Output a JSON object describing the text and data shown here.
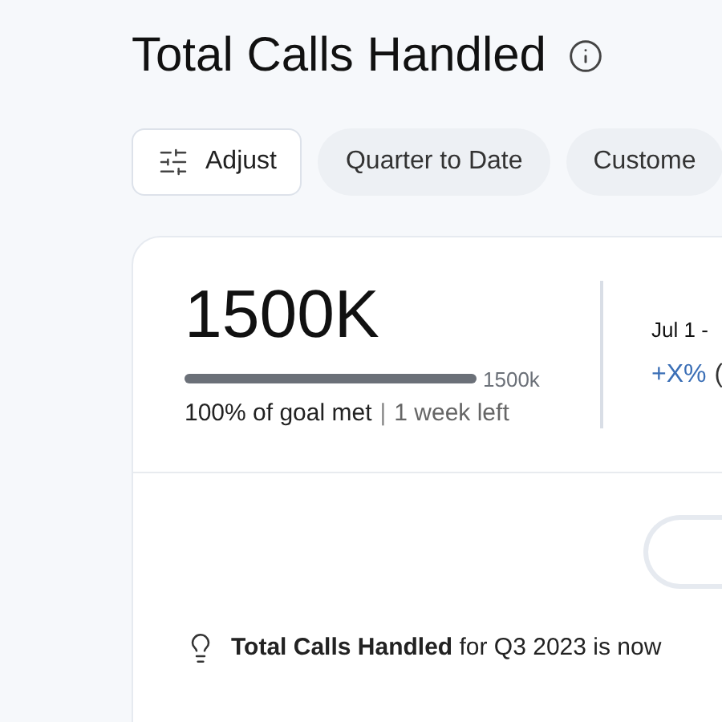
{
  "title": "Total Calls Handled",
  "filters": [
    {
      "kind": "adjust",
      "label": "Adjust"
    },
    {
      "kind": "pill",
      "label": "Quarter to Date"
    },
    {
      "kind": "pill",
      "label": "Custome"
    }
  ],
  "metric": {
    "value": "1500K",
    "goal": "1500k",
    "level": 1,
    "goal_status": "100% of goal met",
    "separator": "|",
    "time_left": "1 week left"
  },
  "period": {
    "range": "Jul 1 -",
    "change": "+X%",
    "change_detail": "("
  },
  "insight": "**Total Calls Handled** for Q3 2023 is now"
}
